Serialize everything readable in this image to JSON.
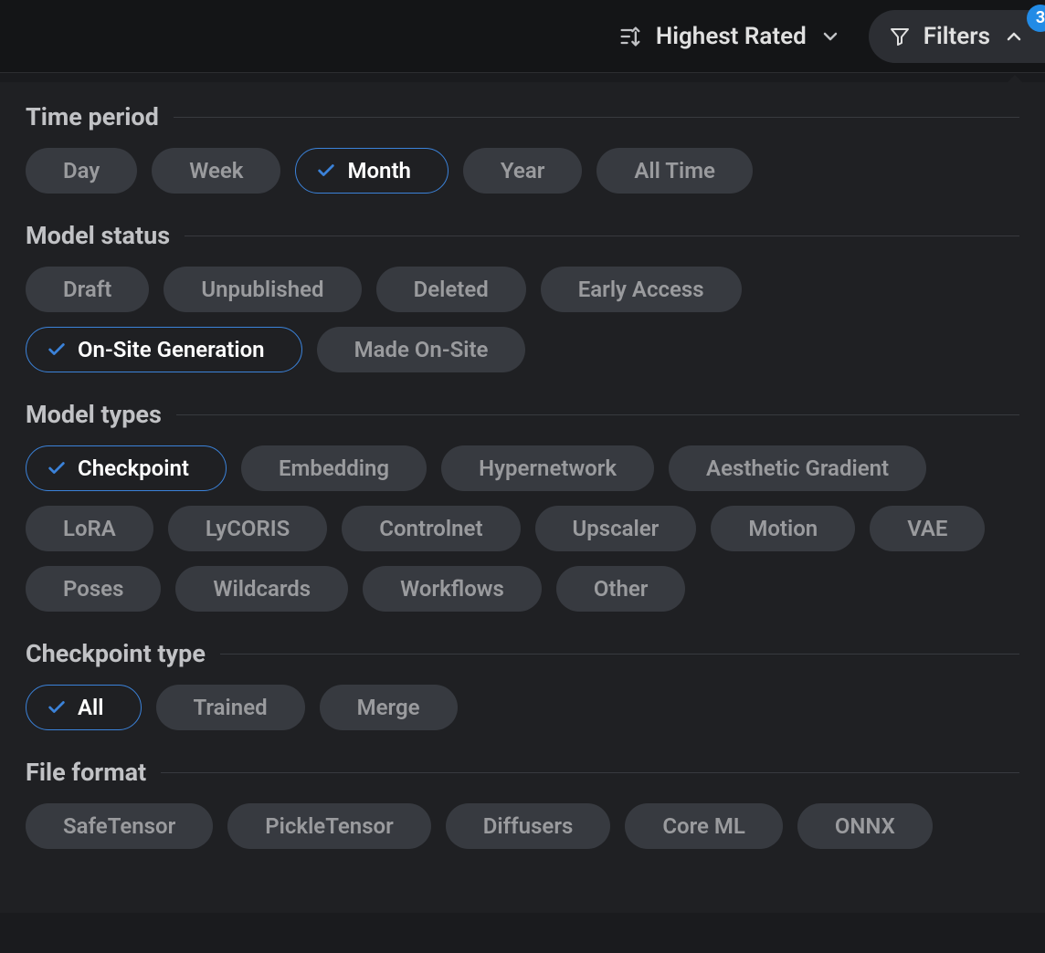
{
  "topbar": {
    "sort_label": "Highest Rated",
    "filters_label": "Filters",
    "filters_badge": "3"
  },
  "sections": {
    "time_period": {
      "title": "Time period",
      "options": [
        {
          "label": "Day",
          "selected": false
        },
        {
          "label": "Week",
          "selected": false
        },
        {
          "label": "Month",
          "selected": true
        },
        {
          "label": "Year",
          "selected": false
        },
        {
          "label": "All Time",
          "selected": false
        }
      ]
    },
    "model_status": {
      "title": "Model status",
      "options": [
        {
          "label": "Draft",
          "selected": false
        },
        {
          "label": "Unpublished",
          "selected": false
        },
        {
          "label": "Deleted",
          "selected": false
        },
        {
          "label": "Early Access",
          "selected": false
        },
        {
          "label": "On-Site Generation",
          "selected": true
        },
        {
          "label": "Made On-Site",
          "selected": false
        }
      ]
    },
    "model_types": {
      "title": "Model types",
      "options": [
        {
          "label": "Checkpoint",
          "selected": true
        },
        {
          "label": "Embedding",
          "selected": false
        },
        {
          "label": "Hypernetwork",
          "selected": false
        },
        {
          "label": "Aesthetic Gradient",
          "selected": false
        },
        {
          "label": "LoRA",
          "selected": false
        },
        {
          "label": "LyCORIS",
          "selected": false
        },
        {
          "label": "Controlnet",
          "selected": false
        },
        {
          "label": "Upscaler",
          "selected": false
        },
        {
          "label": "Motion",
          "selected": false
        },
        {
          "label": "VAE",
          "selected": false
        },
        {
          "label": "Poses",
          "selected": false
        },
        {
          "label": "Wildcards",
          "selected": false
        },
        {
          "label": "Workflows",
          "selected": false
        },
        {
          "label": "Other",
          "selected": false
        }
      ]
    },
    "checkpoint_type": {
      "title": "Checkpoint type",
      "options": [
        {
          "label": "All",
          "selected": true
        },
        {
          "label": "Trained",
          "selected": false
        },
        {
          "label": "Merge",
          "selected": false
        }
      ]
    },
    "file_format": {
      "title": "File format",
      "options": [
        {
          "label": "SafeTensor",
          "selected": false
        },
        {
          "label": "PickleTensor",
          "selected": false
        },
        {
          "label": "Diffusers",
          "selected": false
        },
        {
          "label": "Core ML",
          "selected": false
        },
        {
          "label": "ONNX",
          "selected": false
        }
      ]
    }
  }
}
